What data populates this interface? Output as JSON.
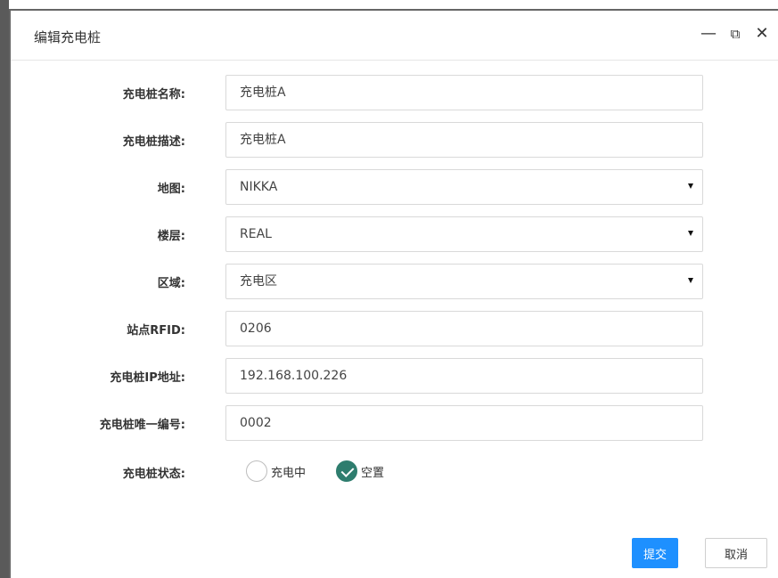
{
  "dialog": {
    "title": "编辑充电桩",
    "controls": {
      "minimize": "—",
      "restore": "⧉",
      "close": "✕"
    }
  },
  "form": {
    "name": {
      "label": "充电桩名称:",
      "value": "充电桩A"
    },
    "description": {
      "label": "充电桩描述:",
      "value": "充电桩A"
    },
    "map": {
      "label": "地图:",
      "value": "NIKKA"
    },
    "floor": {
      "label": "楼层:",
      "value": "REAL"
    },
    "area": {
      "label": "区域:",
      "value": "充电区"
    },
    "rfid": {
      "label": "站点RFID:",
      "value": "0206"
    },
    "ip": {
      "label": "充电桩IP地址:",
      "value": "192.168.100.226"
    },
    "uid": {
      "label": "充电桩唯一编号:",
      "value": "0002"
    },
    "status": {
      "label": "充电桩状态:",
      "options": [
        "充电中",
        "空置"
      ],
      "selected": "空置"
    }
  },
  "actions": {
    "submit": "提交",
    "cancel": "取消"
  },
  "colors": {
    "primary": "#1e90ff",
    "radio_checked": "#2e7d6e"
  }
}
